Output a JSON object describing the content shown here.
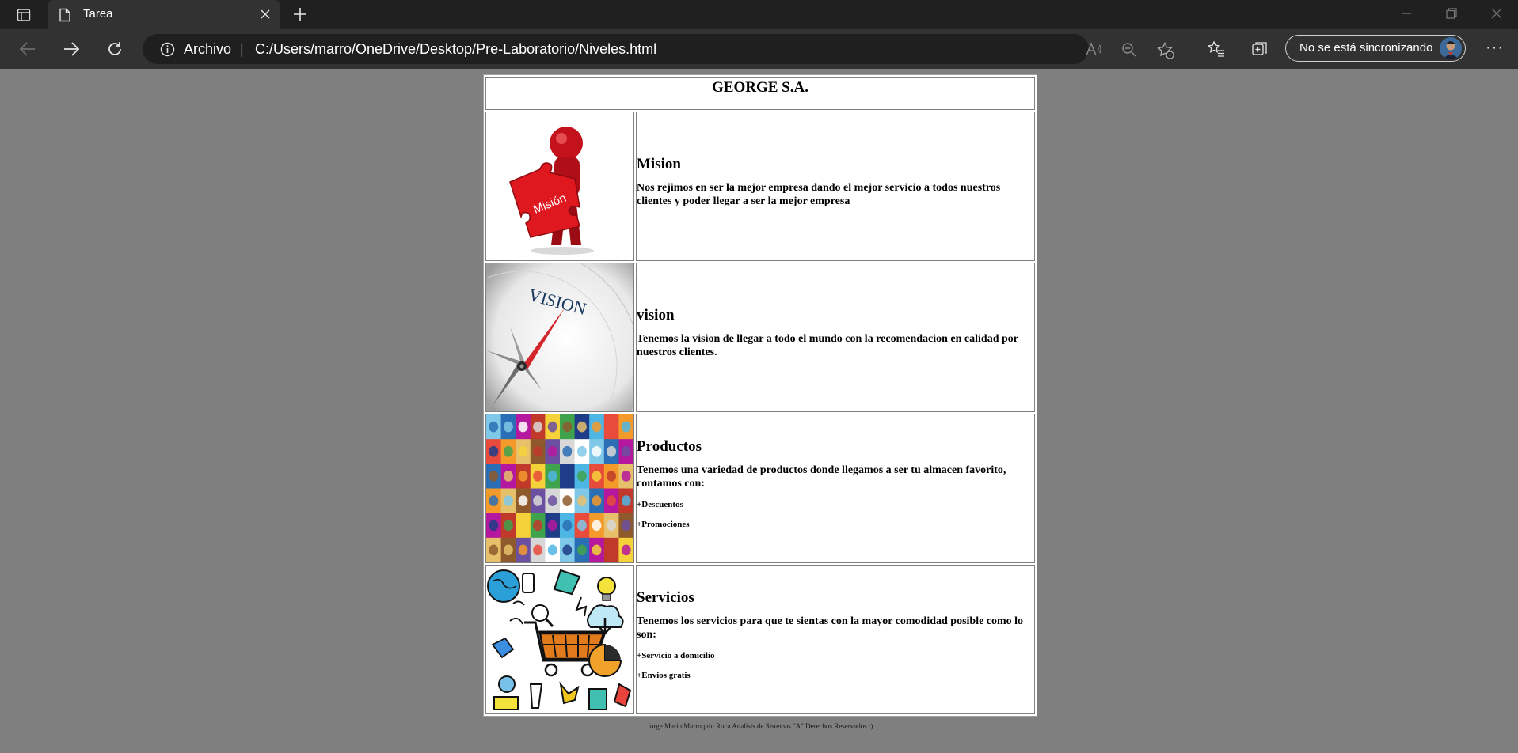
{
  "browser": {
    "tab_title": "Tarea",
    "address_scheme_label": "Archivo",
    "address_separator": "|",
    "url": "C:/Users/marro/OneDrive/Desktop/Pre-Laboratorio/Niveles.html",
    "sync_label": "No se está sincronizando",
    "more_label": "···"
  },
  "page": {
    "company": "GEORGE S.A.",
    "rows": [
      {
        "image_name": "mision-image",
        "image_caption": "Misión",
        "title": "Mision",
        "text": "Nos rejimos en ser la mejor empresa dando el mejor servicio a todos nuestros clientes y poder llegar a ser la mejor empresa",
        "items": []
      },
      {
        "image_name": "vision-compass-image",
        "image_caption": "VISION",
        "title": "vision",
        "text": "Tenemos la vision de llegar a todo el mundo con la recomendacion en calidad por nuestros clientes.",
        "items": []
      },
      {
        "image_name": "products-collage-image",
        "title": "Productos",
        "text": "Tenemos una variedad de productos donde llegamos a ser tu almacen favorito, contamos con:",
        "items": [
          "+Descuentos",
          "+Promociones"
        ]
      },
      {
        "image_name": "services-illustration-image",
        "title": "Servicios",
        "text": "Tenemos los servicios para que te sientas con la mayor comodidad posible como lo son:",
        "items": [
          "+Servicio a domicilio",
          "+Envios gratis"
        ]
      }
    ],
    "footer": "Jorge Mario Marroquin Roca Analisis de Sistemas \"A\" Derechos Reservados :)"
  }
}
